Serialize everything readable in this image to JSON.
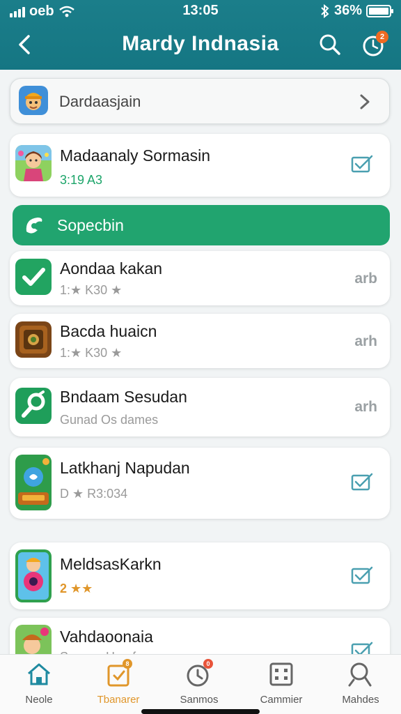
{
  "status_bar": {
    "carrier": "oeb",
    "time": "13:05",
    "battery": "36%"
  },
  "header": {
    "title": "Mardy Indnasia",
    "notification_count": "2"
  },
  "search_card": {
    "label": "Dardaasjain"
  },
  "featured_item": {
    "title": "Madaanaly Sormasin",
    "subtitle": "3:19 A3"
  },
  "section": {
    "label": "Sopecbin"
  },
  "list_items": [
    {
      "title": "Aondaa kakan",
      "subtitle": "1:★ K30 ★",
      "action": "arb"
    },
    {
      "title": "Bacda huaicn",
      "subtitle": "1:★ K30 ★",
      "action": "arh"
    },
    {
      "title": "Bndaam Sesudan",
      "subtitle": "Gunad Os dames",
      "action": "arh"
    },
    {
      "title": "Latkhanj Napudan",
      "subtitle": "D ★ R3:034"
    },
    {
      "title": "MeldsasKarkn",
      "subtitle": "2 ★★"
    },
    {
      "title": "Vahdaoonaia",
      "subtitle": "Sonnas Hoa faun"
    }
  ],
  "bottom_nav": {
    "tabs": [
      {
        "label": "Neole"
      },
      {
        "label": "Tbanarer",
        "badge": "8"
      },
      {
        "label": "Sanmos",
        "badge": "0"
      },
      {
        "label": "Cammier"
      },
      {
        "label": "Mahdes"
      }
    ]
  },
  "colors": {
    "header": "#1b7e8a",
    "accent_green": "#21a46f",
    "check_teal": "#4a9fb0",
    "active_tab": "#e0962a"
  }
}
